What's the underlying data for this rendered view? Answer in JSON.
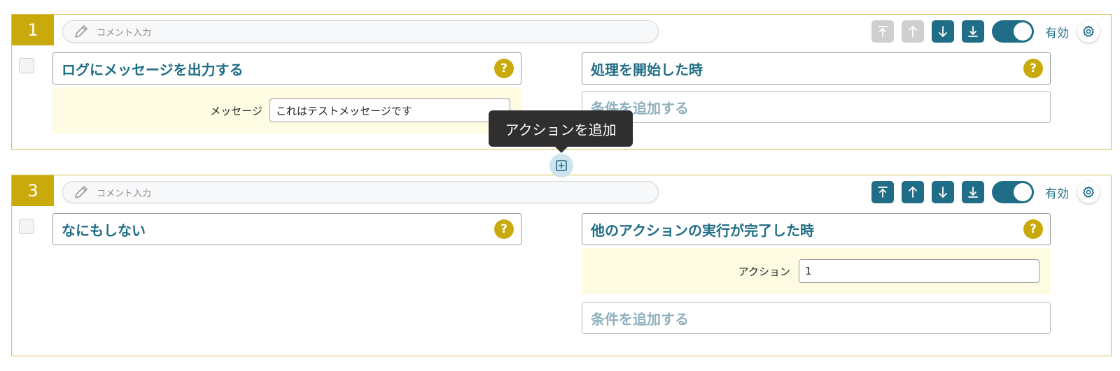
{
  "colors": {
    "accent": "#1f6d86",
    "badge": "#c9aa0c",
    "block_border": "#d7c150",
    "param_bg": "#fefbe3",
    "disabled_button": "#cfcfcf",
    "tooltip_bg": "#2f2f2f"
  },
  "icons": {
    "pencil": "pencil-icon",
    "move_top": "arrow-to-top-icon",
    "move_up": "arrow-up-icon",
    "move_down": "arrow-down-icon",
    "move_bottom": "arrow-to-bottom-icon",
    "settings": "gear-icon",
    "help": "question-icon",
    "add": "plus-square-icon"
  },
  "blocks": [
    {
      "number": "1",
      "comment_placeholder": "コメント入力",
      "enabled_label": "有効",
      "enabled": true,
      "move_top_disabled": true,
      "move_up_disabled": true,
      "action_title": "ログにメッセージを出力する",
      "help_mark": "?",
      "action_param_label": "メッセージ",
      "action_param_value": "これはテストメッセージです",
      "trigger_title": "処理を開始した時",
      "add_condition_label": "条件を追加する"
    },
    {
      "number": "3",
      "comment_placeholder": "コメント入力",
      "enabled_label": "有効",
      "enabled": true,
      "move_top_disabled": false,
      "move_up_disabled": false,
      "action_title": "なにもしない",
      "help_mark": "?",
      "trigger_title": "他のアクションの実行が完了した時",
      "trigger_param_label": "アクション",
      "trigger_param_value": "1",
      "add_condition_label": "条件を追加する"
    }
  ],
  "tooltip": {
    "text": "アクションを追加"
  }
}
